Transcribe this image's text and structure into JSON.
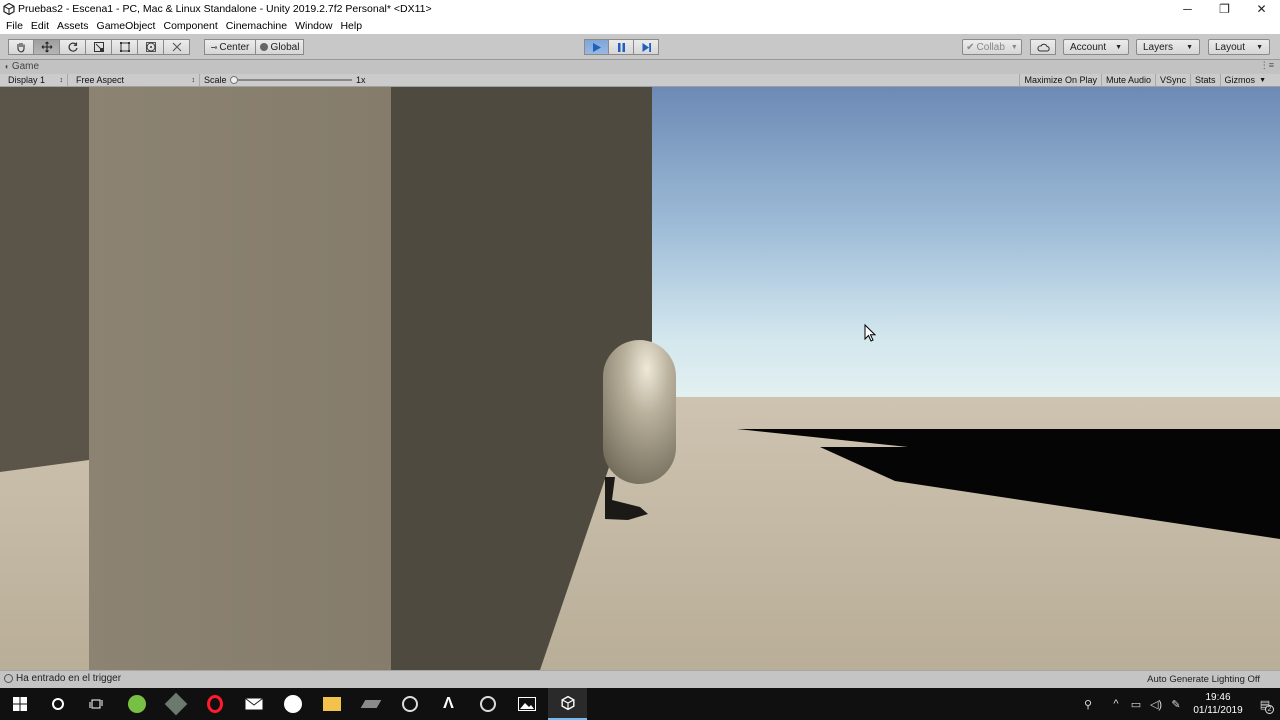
{
  "window": {
    "title": "Pruebas2 - Escena1 - PC, Mac & Linux Standalone - Unity 2019.2.7f2 Personal* <DX11>",
    "minimize": "─",
    "restore": "❐",
    "close": "✕"
  },
  "menu": [
    "File",
    "Edit",
    "Assets",
    "GameObject",
    "Component",
    "Cinemachine",
    "Window",
    "Help"
  ],
  "toolbar": {
    "pivot_label": "Center",
    "space_label": "Global",
    "collab_label": "Collab",
    "account_label": "Account",
    "layers_label": "Layers",
    "layout_label": "Layout",
    "play_active": true
  },
  "game_tab": {
    "label": "Game"
  },
  "game_bar": {
    "display": "Display 1",
    "aspect": "Free Aspect",
    "scale_label": "Scale",
    "scale_value": "1x",
    "maximize_on_play": "Maximize On Play",
    "mute_audio": "Mute Audio",
    "vsync": "VSync",
    "stats": "Stats",
    "gizmos": "Gizmos"
  },
  "status": {
    "message": "Ha entrado en el trigger",
    "lighting": "Auto Generate Lighting Off"
  },
  "taskbar": {
    "time": "19:46",
    "date": "01/11/2019",
    "notification_count": "2"
  },
  "colors": {
    "sky_top": "#6e8cb6",
    "sky_horizon": "#e0eef0",
    "ground": "#bfb4a0",
    "wall_lit": "#8a8170",
    "wall_shadow": "#4f4a40",
    "capsule": "#b8b09b",
    "play_blue": "#4a86d4"
  }
}
